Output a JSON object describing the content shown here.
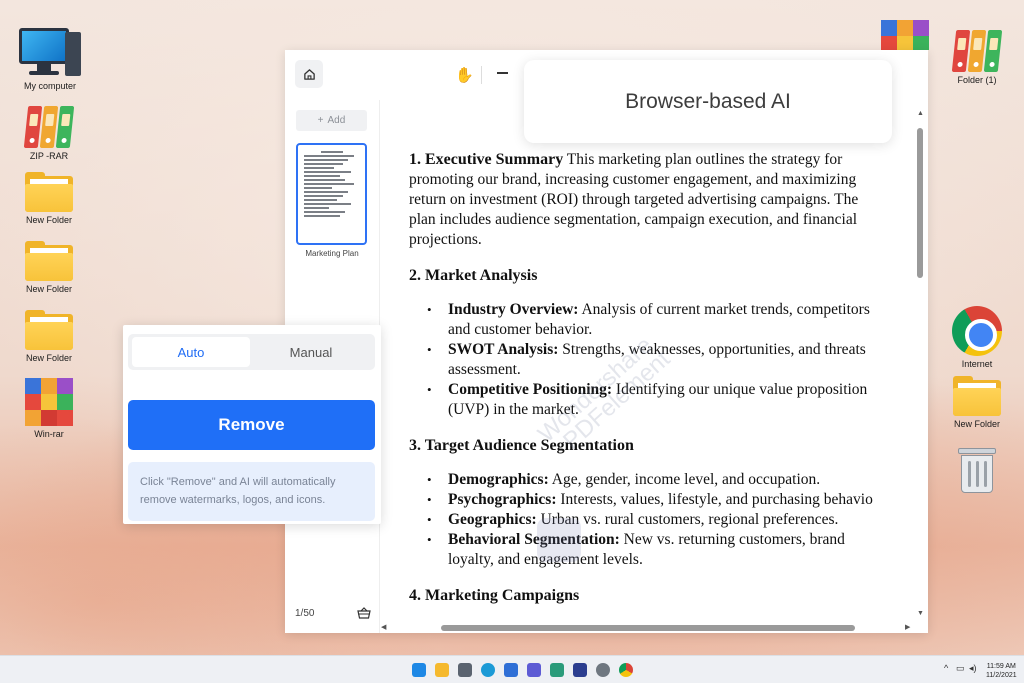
{
  "desktop": {
    "left_icons": [
      {
        "label": "My computer"
      },
      {
        "label": "ZIP -RAR"
      },
      {
        "label": "New Folder"
      },
      {
        "label": "New Folder"
      },
      {
        "label": "New Folder"
      },
      {
        "label": "Win-rar"
      }
    ],
    "right_icons": [
      {
        "label": "Folder (1)"
      },
      {
        "label": "Internet"
      },
      {
        "label": "New Folder"
      }
    ]
  },
  "app": {
    "add_label": "Add",
    "thumbnail_label": "Marketing Plan",
    "page_indicator": "1/50",
    "overlay_title": "Browser-based AI",
    "remove_panel": {
      "tab_auto": "Auto",
      "tab_manual": "Manual",
      "remove_label": "Remove",
      "hint": "Click \"Remove\" and AI will automatically remove watermarks, logos, and icons."
    },
    "watermark": {
      "line1": "Wondershare",
      "line2": "PDFelement"
    },
    "document": {
      "s1_heading": "1. Executive Summary",
      "s1_text_a": " This marketing plan outlines the strategy for",
      "s1_text_b": "promoting our brand, increasing customer engagement, and maximizing",
      "s1_text_c": "return on investment (ROI) through targeted advertising campaigns. The",
      "s1_text_d": "plan includes audience segmentation, campaign execution, and financial",
      "s1_text_e": "projections.",
      "s2_heading": "2. Market Analysis",
      "s2_items": [
        {
          "term": "Industry Overview:",
          "desc": " Analysis of current market trends, competitors",
          "cont": "and customer behavior."
        },
        {
          "term": "SWOT Analysis:",
          "desc": " Strengths, weaknesses, opportunities, and threats",
          "cont": "assessment."
        },
        {
          "term": "Competitive Positioning:",
          "desc": " Identifying our unique value proposition",
          "cont": "(UVP) in the market."
        }
      ],
      "s3_heading": "3. Target Audience Segmentation",
      "s3_items": [
        {
          "term": "Demographics:",
          "desc": " Age, gender, income level, and occupation.",
          "cont": ""
        },
        {
          "term": "Psychographics:",
          "desc": " Interests, values, lifestyle, and purchasing behavio",
          "cont": ""
        },
        {
          "term": "Geographics:",
          "desc": " Urban vs. rural customers, regional preferences.",
          "cont": ""
        },
        {
          "term": "Behavioral Segmentation:",
          "desc": " New vs. returning customers, brand",
          "cont": "loyalty, and engagement levels."
        }
      ],
      "s4_heading": "4. Marketing Campaigns"
    }
  },
  "taskbar": {
    "time": "11:59 AM",
    "date": "11/2/2021"
  }
}
